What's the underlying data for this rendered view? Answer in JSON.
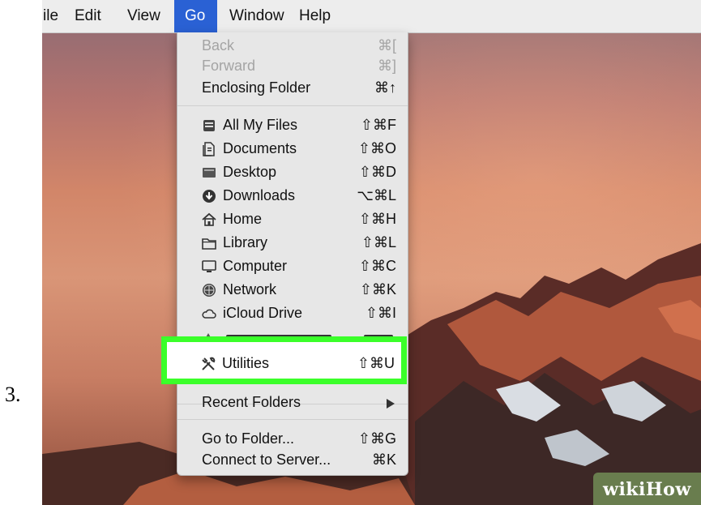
{
  "step_number": "3.",
  "menubar": {
    "items": [
      {
        "label": "ile"
      },
      {
        "label": "Edit"
      },
      {
        "label": "View"
      },
      {
        "label": "Go",
        "active": true
      },
      {
        "label": "Window"
      },
      {
        "label": "Help"
      }
    ]
  },
  "go_menu": {
    "navigation": [
      {
        "label": "Back",
        "shortcut": "⌘[",
        "enabled": false
      },
      {
        "label": "Forward",
        "shortcut": "⌘]",
        "enabled": false
      },
      {
        "label": "Enclosing Folder",
        "shortcut": "⌘↑",
        "enabled": true
      }
    ],
    "places": [
      {
        "label": "All My Files",
        "shortcut": "⇧⌘F",
        "icon": "all-my-files-icon"
      },
      {
        "label": "Documents",
        "shortcut": "⇧⌘O",
        "icon": "documents-icon"
      },
      {
        "label": "Desktop",
        "shortcut": "⇧⌘D",
        "icon": "desktop-icon"
      },
      {
        "label": "Downloads",
        "shortcut": "⌥⌘L",
        "icon": "downloads-icon"
      },
      {
        "label": "Home",
        "shortcut": "⇧⌘H",
        "icon": "home-icon"
      },
      {
        "label": "Library",
        "shortcut": "⇧⌘L",
        "icon": "library-folder-icon"
      },
      {
        "label": "Computer",
        "shortcut": "⇧⌘C",
        "icon": "computer-icon"
      },
      {
        "label": "Network",
        "shortcut": "⇧⌘K",
        "icon": "network-icon"
      },
      {
        "label": "iCloud Drive",
        "shortcut": "⇧⌘I",
        "icon": "cloud-icon"
      }
    ],
    "highlighted": {
      "label": "Utilities",
      "shortcut": "⇧⌘U",
      "icon": "utilities-icon"
    },
    "recent_folders": {
      "label": "Recent Folders"
    },
    "goto": [
      {
        "label": "Go to Folder...",
        "shortcut": "⇧⌘G"
      },
      {
        "label": "Connect to Server...",
        "shortcut": "⌘K"
      }
    ]
  },
  "colors": {
    "menu_highlight": "#2a61d4",
    "callout_border": "#3bff2a"
  },
  "watermark": {
    "text": "wikiHow"
  }
}
